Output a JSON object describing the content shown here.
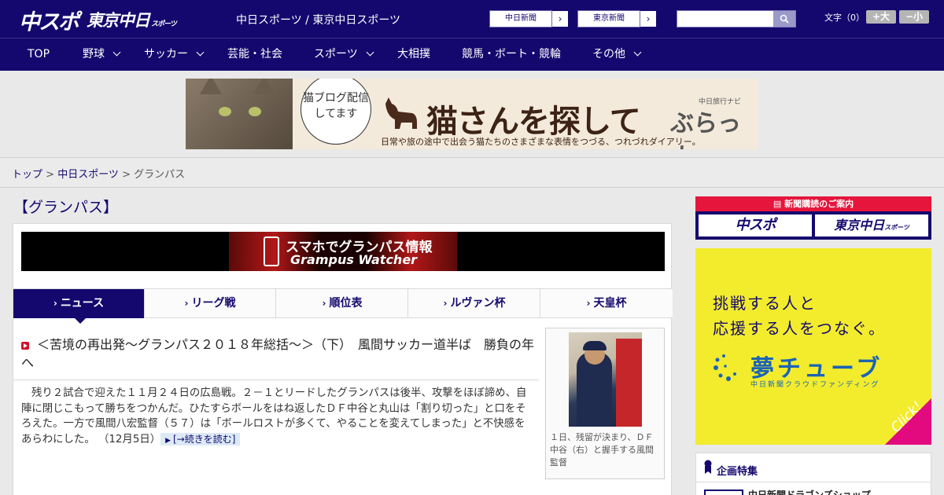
{
  "header": {
    "logo_chuspo": "中スポ",
    "logo_tokyo": "東京中日",
    "logo_tokyo_sub": "スポーツ",
    "site_name": "中日スポーツ / 東京中日スポーツ",
    "site_buttons": [
      "中日新聞",
      "東京新聞"
    ],
    "search": {
      "placeholder": "",
      "value": ""
    },
    "fontsize_label": "文字（0）",
    "fontsize_up": "+大",
    "fontsize_down": "−小"
  },
  "nav": {
    "items": [
      {
        "label": "TOP",
        "has_dropdown": false
      },
      {
        "label": "野球",
        "has_dropdown": true
      },
      {
        "label": "サッカー",
        "has_dropdown": true
      },
      {
        "label": "芸能・社会",
        "has_dropdown": false
      },
      {
        "label": "スポーツ",
        "has_dropdown": true
      },
      {
        "label": "大相撲",
        "has_dropdown": false
      },
      {
        "label": "競馬・ボート・競輪",
        "has_dropdown": false
      },
      {
        "label": "その他",
        "has_dropdown": true
      }
    ]
  },
  "top_ad": {
    "bubble_text": "猫ブログ配信してます",
    "headline": "猫さんを探して",
    "brand_small": "中日旅行ナビ",
    "brand": "ぶらっ人",
    "sub": "日常や旅の途中で出会う猫たちのさまざまな表情をつづる、つれづれダイアリー。"
  },
  "breadcrumb": {
    "items": [
      "トップ",
      "中日スポーツ"
    ],
    "current": "グランパス",
    "separator": " > "
  },
  "page": {
    "title": "【グランパス】"
  },
  "grampus_banner": {
    "line1": "スマホでグランパス情報",
    "line2": "Grampus Watcher"
  },
  "tabs": {
    "items": [
      "ニュース",
      "リーグ戦",
      "順位表",
      "ルヴァン杯",
      "天皇杯"
    ],
    "active": "ニュース"
  },
  "article": {
    "headline": "＜苦境の再出発～グランパス２０１８年総括～＞（下）　風間サッカー道半ば　勝負の年へ",
    "lead": "残り２試合で迎えた１１月２４日の広島戦。２－１とリードしたグランパスは後半、攻撃をほぼ諦め、自陣に閉じこもって勝ちをつかんだ。ひたすらボールをはね返したＤＦ中谷と丸山は「割り切った」と口をそろえた。一方で風間八宏監督（５７）は「ボールロストが多くて、やることを変えてしまった」と不快感をあらわにした。",
    "date": "（12月5日）",
    "more_link": "[→続きを読む]",
    "photo_caption": "１日、残留が決まり、ＤＦ中谷（右）と握手する風間監督"
  },
  "sidebar": {
    "subscribe_heading": "新聞購読のご案内",
    "subscribe_logos": [
      "中スポ",
      "東京中日"
    ],
    "subscribe_logo_sub": "スポーツ",
    "dream_ad": {
      "line1": "挑戦する人と",
      "line2": "応援する人をつなぐ。",
      "logo": "夢チューブ",
      "sub": "中日新聞クラウドファンディング",
      "click": "Click!"
    },
    "feature_title": "企画特集",
    "feature_item": "中日新聞ドラゴンズショップ"
  },
  "colors": {
    "brand_navy": "#14086e",
    "accent_red": "#e5153b",
    "link_bg": "#dbeaf6",
    "dream_yellow": "#f2ec2d",
    "click_pink": "#e20a7e"
  }
}
